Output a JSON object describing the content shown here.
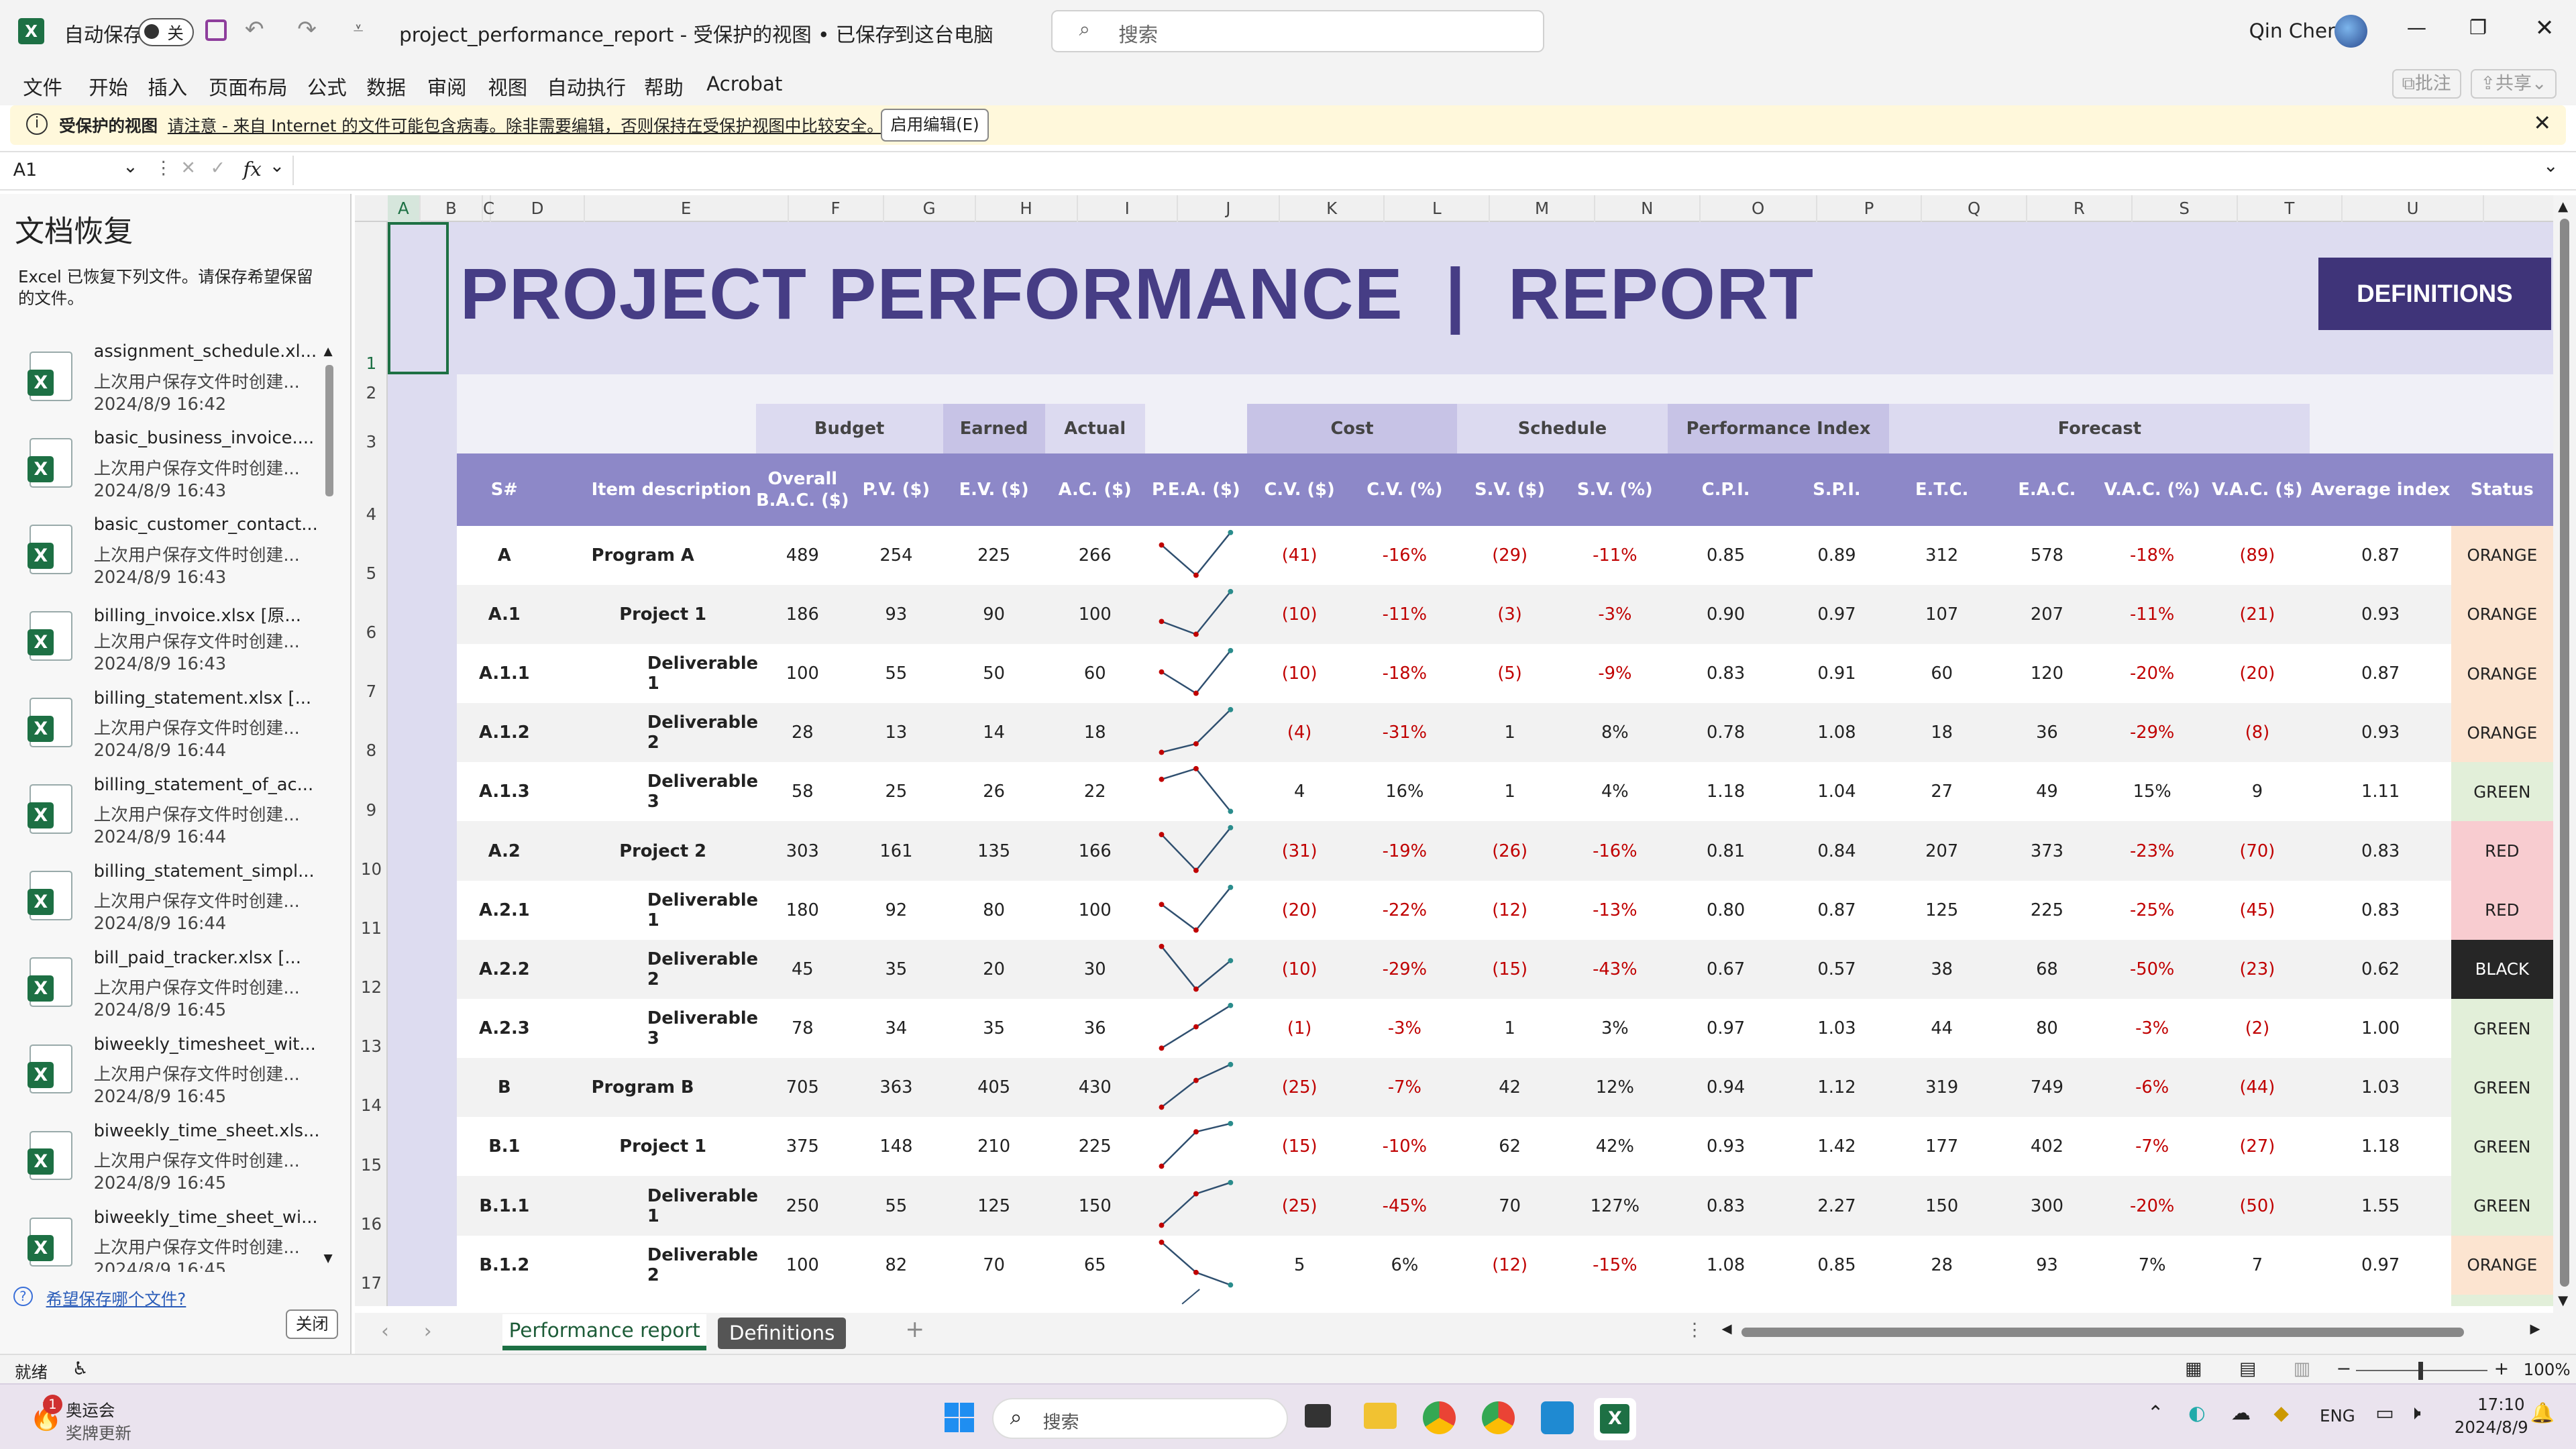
{
  "app": {
    "autosave_label": "自动保存",
    "autosave_state": "关",
    "file_title": "project_performance_report  -  受保护的视图 • 已保存到这台电脑",
    "search_placeholder": "搜索",
    "user_name": "Qin Chen",
    "comment_btn": "批注",
    "share_btn": "共享"
  },
  "menu": [
    "文件",
    "开始",
    "插入",
    "页面布局",
    "公式",
    "数据",
    "审阅",
    "视图",
    "自动执行",
    "帮助",
    "Acrobat"
  ],
  "protected_bar": {
    "label": "受保护的视图",
    "message": "请注意 - 来自 Internet 的文件可能包含病毒。除非需要编辑，否则保持在受保护视图中比较安全。",
    "button": "启用编辑(E)"
  },
  "formula_bar": {
    "name_box": "A1",
    "fx": "fx"
  },
  "recovery": {
    "title": "文档恢复",
    "description": "Excel 已恢复下列文件。请保存希望保留的文件。",
    "items": [
      {
        "name": "assignment_schedule.xl...",
        "desc": "上次用户保存文件时创建...",
        "date": "2024/8/9 16:42"
      },
      {
        "name": "basic_business_invoice....",
        "desc": "上次用户保存文件时创建...",
        "date": "2024/8/9 16:43"
      },
      {
        "name": "basic_customer_contact...",
        "desc": "上次用户保存文件时创建...",
        "date": "2024/8/9 16:43"
      },
      {
        "name": "billing_invoice.xlsx  [原...",
        "desc": "上次用户保存文件时创建...",
        "date": "2024/8/9 16:43"
      },
      {
        "name": "billing_statement.xlsx  [...",
        "desc": "上次用户保存文件时创建...",
        "date": "2024/8/9 16:44"
      },
      {
        "name": "billing_statement_of_ac...",
        "desc": "上次用户保存文件时创建...",
        "date": "2024/8/9 16:44"
      },
      {
        "name": "billing_statement_simpl...",
        "desc": "上次用户保存文件时创建...",
        "date": "2024/8/9 16:44"
      },
      {
        "name": "bill_paid_tracker.xlsx  [...",
        "desc": "上次用户保存文件时创建...",
        "date": "2024/8/9 16:45"
      },
      {
        "name": "biweekly_timesheet_wit...",
        "desc": "上次用户保存文件时创建...",
        "date": "2024/8/9 16:45"
      },
      {
        "name": "biweekly_time_sheet.xls...",
        "desc": "上次用户保存文件时创建...",
        "date": "2024/8/9 16:45"
      },
      {
        "name": "biweekly_time_sheet_wi...",
        "desc": "上次用户保存文件时创建...",
        "date": "2024/8/9 16:45"
      }
    ],
    "help_link": "希望保存哪个文件?",
    "close_btn": "关闭"
  },
  "grid": {
    "columns": [
      "A",
      "B",
      "C",
      "D",
      "E",
      "F",
      "G",
      "H",
      "I",
      "J",
      "K",
      "L",
      "M",
      "N",
      "O",
      "P",
      "Q",
      "R",
      "S",
      "T",
      "U"
    ],
    "rows": [
      "1",
      "2",
      "3",
      "4",
      "5",
      "6",
      "7",
      "8",
      "9",
      "10",
      "11",
      "12",
      "13",
      "14",
      "15",
      "16",
      "17"
    ]
  },
  "report": {
    "title": "PROJECT PERFORMANCE  |  REPORT",
    "definitions_btn": "DEFINITIONS",
    "groups": {
      "budget": "Budget",
      "earned": "Earned",
      "actual": "Actual",
      "cost": "Cost",
      "schedule": "Schedule",
      "perf": "Performance Index",
      "forecast": "Forecast"
    },
    "headers": [
      "S#",
      "Item description",
      "Overall B.A.C. ($)",
      "P.V. ($)",
      "E.V. ($)",
      "A.C. ($)",
      "P.E.A. ($)",
      "C.V. ($)",
      "C.V. (%)",
      "S.V. ($)",
      "S.V. (%)",
      "C.P.I.",
      "S.P.I.",
      "E.T.C.",
      "E.A.C.",
      "V.A.C. (%)",
      "V.A.C. ($)",
      "Average index",
      "Status"
    ],
    "rows": [
      {
        "sn": "A",
        "desc": "Program A",
        "level": 0,
        "bac": "489",
        "pv": "254",
        "ev": "225",
        "ac": "266",
        "cv": "(41)",
        "cvp": "-16%",
        "sv": "(29)",
        "svp": "-11%",
        "cpi": "0.85",
        "spi": "0.89",
        "etc": "312",
        "eac": "578",
        "vacp": "-18%",
        "vac": "(89)",
        "avg": "0.87",
        "status": "ORANGE"
      },
      {
        "sn": "A.1",
        "desc": "Project 1",
        "level": 1,
        "bac": "186",
        "pv": "93",
        "ev": "90",
        "ac": "100",
        "cv": "(10)",
        "cvp": "-11%",
        "sv": "(3)",
        "svp": "-3%",
        "cpi": "0.90",
        "spi": "0.97",
        "etc": "107",
        "eac": "207",
        "vacp": "-11%",
        "vac": "(21)",
        "avg": "0.93",
        "status": "ORANGE"
      },
      {
        "sn": "A.1.1",
        "desc": "Deliverable 1",
        "level": 2,
        "bac": "100",
        "pv": "55",
        "ev": "50",
        "ac": "60",
        "cv": "(10)",
        "cvp": "-18%",
        "sv": "(5)",
        "svp": "-9%",
        "cpi": "0.83",
        "spi": "0.91",
        "etc": "60",
        "eac": "120",
        "vacp": "-20%",
        "vac": "(20)",
        "avg": "0.87",
        "status": "ORANGE"
      },
      {
        "sn": "A.1.2",
        "desc": "Deliverable 2",
        "level": 2,
        "bac": "28",
        "pv": "13",
        "ev": "14",
        "ac": "18",
        "cv": "(4)",
        "cvp": "-31%",
        "sv": "1",
        "svp": "8%",
        "cpi": "0.78",
        "spi": "1.08",
        "etc": "18",
        "eac": "36",
        "vacp": "-29%",
        "vac": "(8)",
        "avg": "0.93",
        "status": "ORANGE"
      },
      {
        "sn": "A.1.3",
        "desc": "Deliverable 3",
        "level": 2,
        "bac": "58",
        "pv": "25",
        "ev": "26",
        "ac": "22",
        "cv": "4",
        "cvp": "16%",
        "sv": "1",
        "svp": "4%",
        "cpi": "1.18",
        "spi": "1.04",
        "etc": "27",
        "eac": "49",
        "vacp": "15%",
        "vac": "9",
        "avg": "1.11",
        "status": "GREEN"
      },
      {
        "sn": "A.2",
        "desc": "Project 2",
        "level": 1,
        "bac": "303",
        "pv": "161",
        "ev": "135",
        "ac": "166",
        "cv": "(31)",
        "cvp": "-19%",
        "sv": "(26)",
        "svp": "-16%",
        "cpi": "0.81",
        "spi": "0.84",
        "etc": "207",
        "eac": "373",
        "vacp": "-23%",
        "vac": "(70)",
        "avg": "0.83",
        "status": "RED"
      },
      {
        "sn": "A.2.1",
        "desc": "Deliverable 1",
        "level": 2,
        "bac": "180",
        "pv": "92",
        "ev": "80",
        "ac": "100",
        "cv": "(20)",
        "cvp": "-22%",
        "sv": "(12)",
        "svp": "-13%",
        "cpi": "0.80",
        "spi": "0.87",
        "etc": "125",
        "eac": "225",
        "vacp": "-25%",
        "vac": "(45)",
        "avg": "0.83",
        "status": "RED"
      },
      {
        "sn": "A.2.2",
        "desc": "Deliverable 2",
        "level": 2,
        "bac": "45",
        "pv": "35",
        "ev": "20",
        "ac": "30",
        "cv": "(10)",
        "cvp": "-29%",
        "sv": "(15)",
        "svp": "-43%",
        "cpi": "0.67",
        "spi": "0.57",
        "etc": "38",
        "eac": "68",
        "vacp": "-50%",
        "vac": "(23)",
        "avg": "0.62",
        "status": "BLACK"
      },
      {
        "sn": "A.2.3",
        "desc": "Deliverable 3",
        "level": 2,
        "bac": "78",
        "pv": "34",
        "ev": "35",
        "ac": "36",
        "cv": "(1)",
        "cvp": "-3%",
        "sv": "1",
        "svp": "3%",
        "cpi": "0.97",
        "spi": "1.03",
        "etc": "44",
        "eac": "80",
        "vacp": "-3%",
        "vac": "(2)",
        "avg": "1.00",
        "status": "GREEN"
      },
      {
        "sn": "B",
        "desc": "Program B",
        "level": 0,
        "bac": "705",
        "pv": "363",
        "ev": "405",
        "ac": "430",
        "cv": "(25)",
        "cvp": "-7%",
        "sv": "42",
        "svp": "12%",
        "cpi": "0.94",
        "spi": "1.12",
        "etc": "319",
        "eac": "749",
        "vacp": "-6%",
        "vac": "(44)",
        "avg": "1.03",
        "status": "GREEN"
      },
      {
        "sn": "B.1",
        "desc": "Project 1",
        "level": 1,
        "bac": "375",
        "pv": "148",
        "ev": "210",
        "ac": "225",
        "cv": "(15)",
        "cvp": "-10%",
        "sv": "62",
        "svp": "42%",
        "cpi": "0.93",
        "spi": "1.42",
        "etc": "177",
        "eac": "402",
        "vacp": "-7%",
        "vac": "(27)",
        "avg": "1.18",
        "status": "GREEN"
      },
      {
        "sn": "B.1.1",
        "desc": "Deliverable 1",
        "level": 2,
        "bac": "250",
        "pv": "55",
        "ev": "125",
        "ac": "150",
        "cv": "(25)",
        "cvp": "-45%",
        "sv": "70",
        "svp": "127%",
        "cpi": "0.83",
        "spi": "2.27",
        "etc": "150",
        "eac": "300",
        "vacp": "-20%",
        "vac": "(50)",
        "avg": "1.55",
        "status": "GREEN"
      },
      {
        "sn": "B.1.2",
        "desc": "Deliverable 2",
        "level": 2,
        "bac": "100",
        "pv": "82",
        "ev": "70",
        "ac": "65",
        "cv": "5",
        "cvp": "6%",
        "sv": "(12)",
        "svp": "-15%",
        "cpi": "1.08",
        "spi": "0.85",
        "etc": "28",
        "eac": "93",
        "vacp": "7%",
        "vac": "7",
        "avg": "0.97",
        "status": "ORANGE"
      }
    ],
    "status_colors": {
      "ORANGE": "#fce4d0",
      "GREEN": "#e2efd9",
      "RED": "#f8ccd0",
      "BLACK": "#262626"
    },
    "accent": "#3f3479",
    "header_band": "#8d88c8"
  },
  "sheet_tabs": [
    "Performance report",
    "Definitions"
  ],
  "status": {
    "ready": "就绪",
    "zoom": "100%"
  },
  "taskbar": {
    "news_title": "奥运会",
    "news_sub": "奖牌更新",
    "search": "搜索",
    "lang": "ENG",
    "time": "17:10",
    "date": "2024/8/9"
  }
}
